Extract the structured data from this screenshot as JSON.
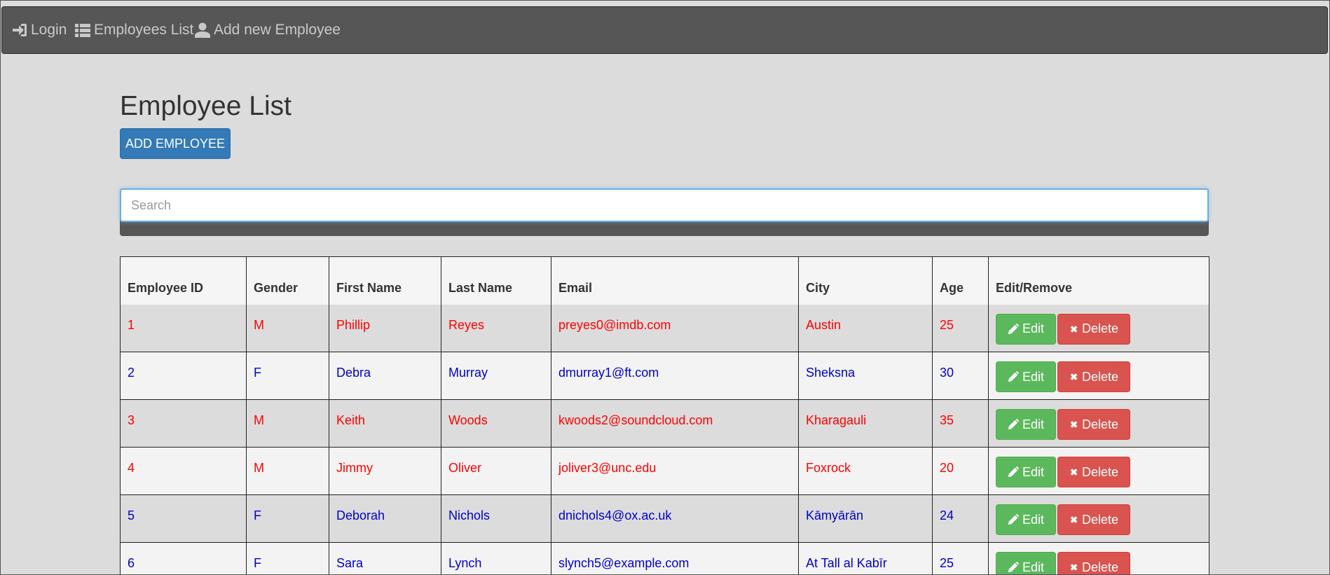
{
  "nav": {
    "login": {
      "label": "Login",
      "icon": "sign-in-icon"
    },
    "employees_list": {
      "label": "Employees List",
      "icon": "list-icon"
    },
    "add_new_employee": {
      "label": "Add new Employee",
      "icon": "user-icon"
    }
  },
  "page": {
    "title": "Employee List",
    "add_button_label": "ADD EMPLOYEE"
  },
  "search": {
    "placeholder": "Search",
    "value": ""
  },
  "table": {
    "headers": [
      "Employee ID",
      "Gender",
      "First Name",
      "Last Name",
      "Email",
      "City",
      "Age",
      "Edit/Remove"
    ],
    "rows": [
      {
        "id": "1",
        "gender": "M",
        "first_name": "Phillip",
        "last_name": "Reyes",
        "email": "preyes0@imdb.com",
        "city": "Austin",
        "age": "25",
        "edit_label": "Edit",
        "delete_label": "Delete"
      },
      {
        "id": "2",
        "gender": "F",
        "first_name": "Debra",
        "last_name": "Murray",
        "email": "dmurray1@ft.com",
        "city": "Sheksna",
        "age": "30",
        "edit_label": "Edit",
        "delete_label": "Delete"
      },
      {
        "id": "3",
        "gender": "M",
        "first_name": "Keith",
        "last_name": "Woods",
        "email": "kwoods2@soundcloud.com",
        "city": "Kharagauli",
        "age": "35",
        "edit_label": "Edit",
        "delete_label": "Delete"
      },
      {
        "id": "4",
        "gender": "M",
        "first_name": "Jimmy",
        "last_name": "Oliver",
        "email": "joliver3@unc.edu",
        "city": "Foxrock",
        "age": "20",
        "edit_label": "Edit",
        "delete_label": "Delete"
      },
      {
        "id": "5",
        "gender": "F",
        "first_name": "Deborah",
        "last_name": "Nichols",
        "email": "dnichols4@ox.ac.uk",
        "city": "Kāmyārān",
        "age": "24",
        "edit_label": "Edit",
        "delete_label": "Delete"
      },
      {
        "id": "6",
        "gender": "F",
        "first_name": "Sara",
        "last_name": "Lynch",
        "email": "slynch5@example.com",
        "city": "At Tall al Kabīr",
        "age": "25",
        "edit_label": "Edit",
        "delete_label": "Delete"
      }
    ]
  },
  "colors": {
    "male_text": "#ff0000",
    "female_text": "#0000cc",
    "navbar_bg": "#565656",
    "primary": "#337ab7",
    "success": "#5cb85c",
    "danger": "#d9534f"
  }
}
